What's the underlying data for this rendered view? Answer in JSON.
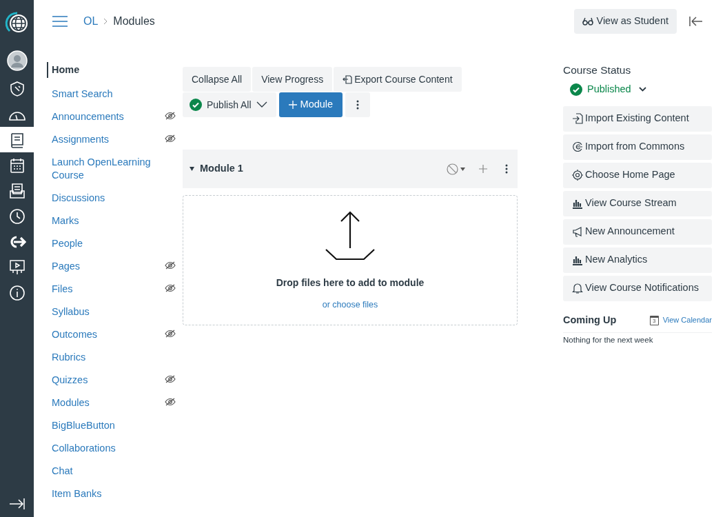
{
  "global_nav": [
    {
      "kind": "logo",
      "selected": false
    },
    {
      "kind": "avatar",
      "selected": false
    },
    {
      "kind": "shield",
      "selected": false
    },
    {
      "kind": "gauge",
      "selected": false
    },
    {
      "kind": "book",
      "selected": true
    },
    {
      "kind": "calendar",
      "selected": false
    },
    {
      "kind": "inbox",
      "selected": false
    },
    {
      "kind": "clock",
      "selected": false
    },
    {
      "kind": "arrow",
      "selected": false
    },
    {
      "kind": "presentation",
      "selected": false
    },
    {
      "kind": "info",
      "selected": false
    }
  ],
  "breadcrumbs": [
    "OL",
    "Modules"
  ],
  "view_as_student": "View as Student",
  "course_nav": [
    {
      "label": "Home",
      "selected": true,
      "hidden": false
    },
    {
      "label": "Smart Search",
      "selected": false,
      "hidden": false
    },
    {
      "label": "Announcements",
      "selected": false,
      "hidden": true
    },
    {
      "label": "Assignments",
      "selected": false,
      "hidden": true
    },
    {
      "label": "Launch OpenLearning Course",
      "selected": false,
      "hidden": false
    },
    {
      "label": "Discussions",
      "selected": false,
      "hidden": false
    },
    {
      "label": "Marks",
      "selected": false,
      "hidden": false
    },
    {
      "label": "People",
      "selected": false,
      "hidden": false
    },
    {
      "label": "Pages",
      "selected": false,
      "hidden": true
    },
    {
      "label": "Files",
      "selected": false,
      "hidden": true
    },
    {
      "label": "Syllabus",
      "selected": false,
      "hidden": false
    },
    {
      "label": "Outcomes",
      "selected": false,
      "hidden": true
    },
    {
      "label": "Rubrics",
      "selected": false,
      "hidden": false
    },
    {
      "label": "Quizzes",
      "selected": false,
      "hidden": true
    },
    {
      "label": "Modules",
      "selected": false,
      "hidden": true
    },
    {
      "label": "BigBlueButton",
      "selected": false,
      "hidden": false
    },
    {
      "label": "Collaborations",
      "selected": false,
      "hidden": false
    },
    {
      "label": "Chat",
      "selected": false,
      "hidden": false
    },
    {
      "label": "Item Banks",
      "selected": false,
      "hidden": false
    }
  ],
  "toolbar": [
    {
      "label": "Collapse All",
      "kind": "plain"
    },
    {
      "label": "View Progress",
      "kind": "plain"
    },
    {
      "label": "Export Course Content",
      "kind": "export"
    }
  ],
  "publish_all": {
    "label": "Publish All",
    "published": true
  },
  "add_module": "Module",
  "modules": [
    {
      "title": "Module 1",
      "expanded": true,
      "published": false
    }
  ],
  "dropzone": {
    "message": "Drop files here to add to module",
    "link": "or choose files"
  },
  "course_status": {
    "title": "Course Status",
    "status": "Published",
    "published": true
  },
  "sidebar_actions": [
    {
      "label": "Import Existing Content",
      "kind": "import"
    },
    {
      "label": "Import from Commons",
      "kind": "commons"
    },
    {
      "label": "Choose Home Page",
      "kind": "target"
    },
    {
      "label": "View Course Stream",
      "kind": "chart"
    },
    {
      "label": "New Announcement",
      "kind": "megaphone"
    },
    {
      "label": "New Analytics",
      "kind": "chart"
    },
    {
      "label": "View Course Notifications",
      "kind": "bell"
    }
  ],
  "coming_up": {
    "title": "Coming Up",
    "link": "View Calendar",
    "calendar_day": "3",
    "empty": "Nothing for the next week"
  }
}
